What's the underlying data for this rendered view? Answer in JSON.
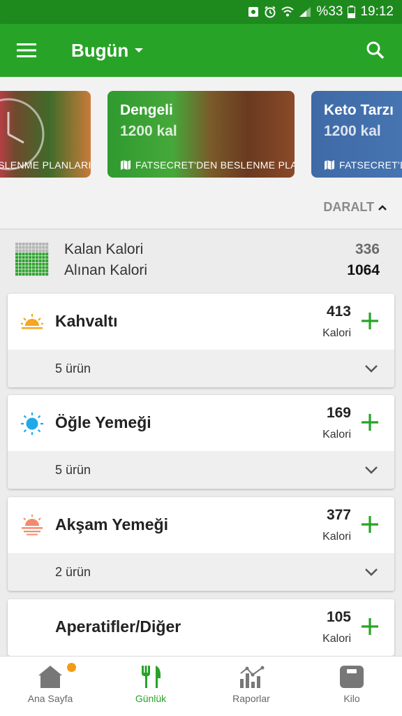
{
  "status_bar": {
    "battery": "%33",
    "time": "19:12"
  },
  "app_bar": {
    "title": "Bugün"
  },
  "plans": [
    {
      "title": "",
      "calories": "",
      "footer": "FATSECRET'DEN BESLENME PLANLARI"
    },
    {
      "title": "Dengeli",
      "calories": "1200 kal",
      "footer": "FATSECRET'DEN BESLENME PLANLARI"
    },
    {
      "title": "Keto Tarzı",
      "calories": "1200 kal",
      "footer": "FATSECRET'DEN BESLENME PLANLARI"
    }
  ],
  "collapse": {
    "label": "DARALT"
  },
  "summary": {
    "remaining_label": "Kalan Kalori",
    "remaining_value": "336",
    "consumed_label": "Alınan Kalori",
    "consumed_value": "1064"
  },
  "meals": [
    {
      "name": "Kahvaltı",
      "calories": "413",
      "unit": "Kalori",
      "items": "5 ürün",
      "icon": "sunrise-icon",
      "color": "#f5a623"
    },
    {
      "name": "Öğle Yemeği",
      "calories": "169",
      "unit": "Kalori",
      "items": "5 ürün",
      "icon": "sun-icon",
      "color": "#1fa9e8"
    },
    {
      "name": "Akşam Yemeği",
      "calories": "377",
      "unit": "Kalori",
      "items": "2 ürün",
      "icon": "sunset-icon",
      "color": "#f28b6e"
    },
    {
      "name": "Aperatifler/Diğer",
      "calories": "105",
      "unit": "Kalori",
      "items": "",
      "icon": "moon-icon",
      "color": "#8e44ad"
    }
  ],
  "bottom_nav": [
    {
      "label": "Ana Sayfa",
      "icon": "home-icon"
    },
    {
      "label": "Günlük",
      "icon": "fork-knife-icon"
    },
    {
      "label": "Raporlar",
      "icon": "chart-icon"
    },
    {
      "label": "Kilo",
      "icon": "scale-icon"
    }
  ],
  "colors": {
    "primary": "#27a327",
    "status_bar": "#1e8a1e",
    "accent_badge": "#f39c12"
  }
}
